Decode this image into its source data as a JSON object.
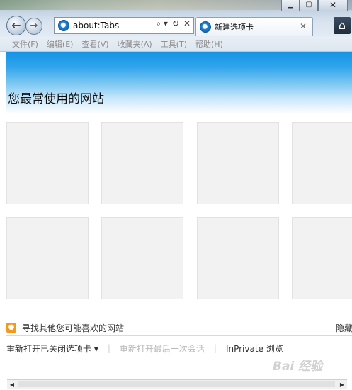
{
  "window": {
    "minimize_icon": "minimize-icon",
    "maximize_icon": "maximize-icon",
    "close_glyph": "✕"
  },
  "navigation": {
    "address": "about:Tabs",
    "search_glyph": "⌕ ▾",
    "refresh_glyph": "↻",
    "stop_glyph": "✕"
  },
  "tab": {
    "label": "新建选项卡",
    "close_glyph": "✕"
  },
  "menu": {
    "items": [
      "文件(F)",
      "编辑(E)",
      "查看(V)",
      "收藏夹(A)",
      "工具(T)",
      "帮助(H)"
    ]
  },
  "page": {
    "heading": "您最常使用的网站",
    "discover_text": "寻找其他您可能喜欢的网站",
    "hide_label": "隐藏",
    "reopen_closed_tabs": "重新打开已关闭选项卡 ▾",
    "reopen_last_session": "重新打开最后一次会话",
    "inprivate": "InPrivate 浏览",
    "divider": "|"
  },
  "watermark": "Bai 经验",
  "colors": {
    "banner": "#1593e4",
    "bulb": "#f39a1e",
    "chrome": "#c4d3e3"
  }
}
